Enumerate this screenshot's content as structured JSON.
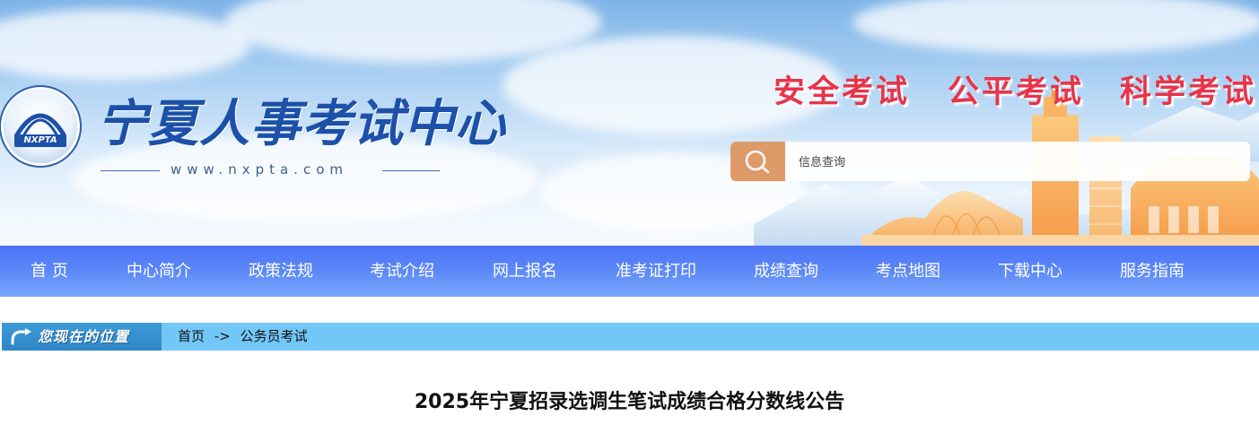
{
  "header": {
    "site_title": "宁夏人事考试中心",
    "site_url": "www.nxpta.com",
    "logo_text": "NXPTA",
    "slogans": [
      "安全考试",
      "公平考试",
      "科学考试"
    ],
    "search": {
      "placeholder": "信息查询",
      "icon": "search-icon"
    },
    "colors": {
      "slogan": "#e8344a",
      "search_button": "#df9a6a",
      "title": "#1d50a8"
    }
  },
  "nav": {
    "items": [
      {
        "label": "首 页"
      },
      {
        "label": "中心简介"
      },
      {
        "label": "政策法规"
      },
      {
        "label": "考试介绍"
      },
      {
        "label": "网上报名"
      },
      {
        "label": "准考证打印"
      },
      {
        "label": "成绩查询"
      },
      {
        "label": "考点地图"
      },
      {
        "label": "下载中心"
      },
      {
        "label": "服务指南"
      }
    ],
    "colors": {
      "top": "#4c74f6",
      "bottom": "#7aa8fb"
    }
  },
  "breadcrumb": {
    "tag": "您现在的位置",
    "tag_icon": "return-arrow-icon",
    "items": [
      "首页",
      "公务员考试"
    ],
    "separator": "->"
  },
  "article": {
    "title": "2025年宁夏招录选调生笔试成绩合格分数线公告"
  }
}
